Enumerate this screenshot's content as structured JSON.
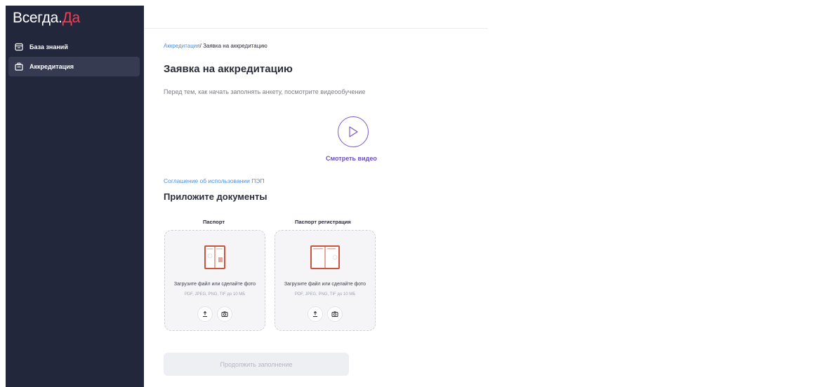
{
  "sidebar": {
    "logo_main": "Всегда",
    "logo_dot": ".",
    "logo_accent": "Да",
    "items": [
      {
        "label": "База знаний",
        "icon": "knowledge-base-icon"
      },
      {
        "label": "Аккредитация",
        "icon": "accreditation-icon"
      }
    ]
  },
  "breadcrumb": {
    "link": "Аккредитация",
    "separator": "/",
    "current": " Заявка на аккредитацию"
  },
  "page": {
    "title": "Заявка на аккредитацию",
    "subtitle": "Перед тем, как начать заполнять анкету, посмотрите видеообучение",
    "watch_video": "Смотреть видео",
    "agreement_link": "Соглашение об использовании ПЭП",
    "docs_title": "Приложите документы",
    "continue_button": "Продолжить заполнение"
  },
  "documents": [
    {
      "label": "Паспорт",
      "hint": "Загрузите файл или сделайте фото",
      "formats": "PDF, JPEG, PNG, TIF до 10 МБ"
    },
    {
      "label": "Паспорт регистрация",
      "hint": "Загрузите файл или сделайте фото",
      "formats": "PDF, JPEG, PNG, TIF до 10 МБ"
    }
  ],
  "colors": {
    "sidebar_bg": "#23273b",
    "accent_red": "#ff3b4e",
    "link_blue": "#4f8fe0",
    "purple": "#6b4fbf",
    "doc_red": "#c9553e"
  }
}
